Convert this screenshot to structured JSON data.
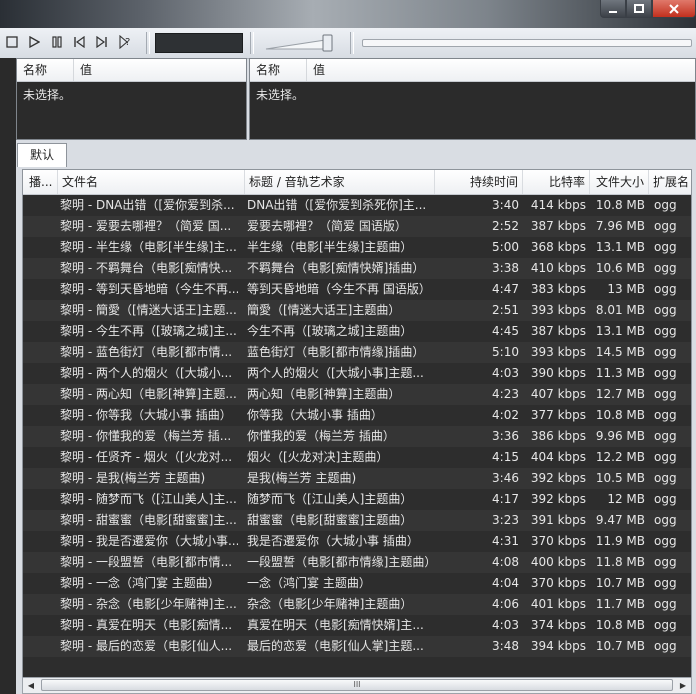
{
  "window": {
    "minimize_icon": "minimize-icon",
    "maximize_icon": "maximize-icon",
    "close_icon": "close-icon"
  },
  "toolbar": {
    "buttons": [
      "stop-icon",
      "play-icon",
      "pause-icon",
      "previous-icon",
      "next-icon",
      "random-icon"
    ],
    "volume_level": 0.85,
    "seek_position": 0.0
  },
  "properties_left": {
    "col_name": "名称",
    "col_value": "值",
    "empty_text": "未选择。"
  },
  "properties_right": {
    "col_name": "名称",
    "col_value": "值",
    "empty_text": "未选择。"
  },
  "tabs": [
    {
      "label": "默认"
    }
  ],
  "playlist": {
    "columns": {
      "playing": "播...",
      "filename": "文件名",
      "title": "标题 / 音轨艺术家",
      "duration": "持续时间",
      "bitrate": "比特率",
      "size": "文件大小",
      "ext": "扩展名"
    },
    "rows": [
      {
        "file": "黎明 - DNA出错（[爱你爱到杀...",
        "title": "DNA出错（[爱你爱到杀死你]主...",
        "duration": "3:40",
        "bitrate": "414 kbps",
        "size": "10.8 MB",
        "ext": "ogg"
      },
      {
        "file": "黎明 - 爱要去哪裡？（简爱 国...",
        "title": "爱要去哪裡？（简爱 国语版）",
        "duration": "2:52",
        "bitrate": "387 kbps",
        "size": "7.96 MB",
        "ext": "ogg"
      },
      {
        "file": "黎明 - 半生缘（电影[半生缘]主...",
        "title": "半生缘（电影[半生缘]主题曲）",
        "duration": "5:00",
        "bitrate": "368 kbps",
        "size": "13.1 MB",
        "ext": "ogg"
      },
      {
        "file": "黎明 - 不羁舞台（电影[痴情快...",
        "title": "不羁舞台（电影[痴情快婿]插曲）",
        "duration": "3:38",
        "bitrate": "410 kbps",
        "size": "10.6 MB",
        "ext": "ogg"
      },
      {
        "file": "黎明 - 等到天昏地暗（今生不再...",
        "title": "等到天昏地暗（今生不再 国语版）",
        "duration": "4:47",
        "bitrate": "383 kbps",
        "size": "13 MB",
        "ext": "ogg"
      },
      {
        "file": "黎明 - 簡愛（[情迷大话王]主题...",
        "title": "簡愛（[情迷大话王]主题曲）",
        "duration": "2:51",
        "bitrate": "393 kbps",
        "size": "8.01 MB",
        "ext": "ogg"
      },
      {
        "file": "黎明 - 今生不再（[玻璃之城]主...",
        "title": "今生不再（[玻璃之城]主题曲）",
        "duration": "4:45",
        "bitrate": "387 kbps",
        "size": "13.1 MB",
        "ext": "ogg"
      },
      {
        "file": "黎明 - 蓝色街灯（电影[都市情...",
        "title": "蓝色街灯（电影[都市情缘]插曲）",
        "duration": "5:10",
        "bitrate": "393 kbps",
        "size": "14.5 MB",
        "ext": "ogg"
      },
      {
        "file": "黎明 - 两个人的烟火（[大城小...",
        "title": "两个人的烟火（[大城小事]主题...",
        "duration": "4:03",
        "bitrate": "390 kbps",
        "size": "11.3 MB",
        "ext": "ogg"
      },
      {
        "file": "黎明 - 两心知（电影[神算]主题...",
        "title": "两心知（电影[神算]主题曲）",
        "duration": "4:23",
        "bitrate": "407 kbps",
        "size": "12.7 MB",
        "ext": "ogg"
      },
      {
        "file": "黎明 - 你等我（大城小事 插曲）",
        "title": "你等我（大城小事 插曲）",
        "duration": "4:02",
        "bitrate": "377 kbps",
        "size": "10.8 MB",
        "ext": "ogg"
      },
      {
        "file": "黎明 - 你懂我的爱（梅兰芳 插...",
        "title": "你懂我的爱（梅兰芳 插曲）",
        "duration": "3:36",
        "bitrate": "386 kbps",
        "size": "9.96 MB",
        "ext": "ogg"
      },
      {
        "file": "黎明 - 任贤齐 - 烟火（[火龙对...",
        "title": "烟火（[火龙对决]主题曲）",
        "duration": "4:15",
        "bitrate": "404 kbps",
        "size": "12.2 MB",
        "ext": "ogg"
      },
      {
        "file": "黎明 - 是我(梅兰芳 主题曲)",
        "title": "是我(梅兰芳 主题曲)",
        "duration": "3:46",
        "bitrate": "392 kbps",
        "size": "10.5 MB",
        "ext": "ogg"
      },
      {
        "file": "黎明 - 随梦而飞（[江山美人]主...",
        "title": "随梦而飞（[江山美人]主题曲）",
        "duration": "4:17",
        "bitrate": "392 kbps",
        "size": "12 MB",
        "ext": "ogg"
      },
      {
        "file": "黎明 - 甜蜜蜜（电影[甜蜜蜜]主...",
        "title": "甜蜜蜜（电影[甜蜜蜜]主题曲）",
        "duration": "3:23",
        "bitrate": "391 kbps",
        "size": "9.47 MB",
        "ext": "ogg"
      },
      {
        "file": "黎明 - 我是否遷爱你（大城小事...",
        "title": "我是否遷爱你（大城小事 插曲）",
        "duration": "4:31",
        "bitrate": "370 kbps",
        "size": "11.9 MB",
        "ext": "ogg"
      },
      {
        "file": "黎明 - 一段盟誓（电影[都市情...",
        "title": "一段盟誓（电影[都市情缘]主题曲）",
        "duration": "4:08",
        "bitrate": "400 kbps",
        "size": "11.8 MB",
        "ext": "ogg"
      },
      {
        "file": "黎明 - 一念（鸿门宴 主题曲）",
        "title": "一念（鸿门宴 主题曲）",
        "duration": "4:04",
        "bitrate": "370 kbps",
        "size": "10.7 MB",
        "ext": "ogg"
      },
      {
        "file": "黎明 - 杂念（电影[少年赌神]主...",
        "title": "杂念（电影[少年赌神]主题曲）",
        "duration": "4:06",
        "bitrate": "401 kbps",
        "size": "11.7 MB",
        "ext": "ogg"
      },
      {
        "file": "黎明 - 真爱在明天（电影[痴情...",
        "title": "真爱在明天（电影[痴情快婿]主...",
        "duration": "4:03",
        "bitrate": "374 kbps",
        "size": "10.8 MB",
        "ext": "ogg"
      },
      {
        "file": "黎明 - 最后的恋爱（电影[仙人...",
        "title": "最后的恋爱（电影[仙人掌]主题...",
        "duration": "3:48",
        "bitrate": "394 kbps",
        "size": "10.7 MB",
        "ext": "ogg"
      }
    ]
  },
  "scrollbar": {
    "thumb_grip": "III"
  }
}
